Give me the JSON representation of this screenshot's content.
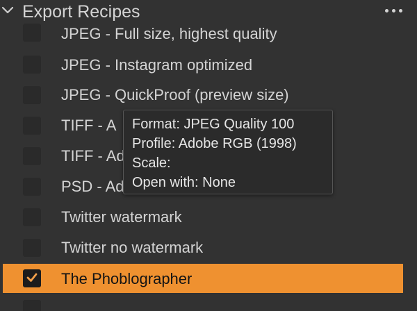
{
  "colors": {
    "background": "#323232",
    "selected_row": "#ef9130",
    "checkbox_fill": "#2a2a2a",
    "tooltip_bg": "#2b2b2b",
    "text": "#d4d4d4"
  },
  "header": {
    "title": "Export Recipes",
    "collapse_icon": "chevron-down-icon",
    "menu_icon": "more-horizontal-icon"
  },
  "recipes": [
    {
      "label": "JPEG - Full size, highest quality",
      "checked": false
    },
    {
      "label": "JPEG - Instagram optimized",
      "checked": false
    },
    {
      "label": "JPEG - QuickProof (preview size)",
      "checked": false
    },
    {
      "label": "TIFF - A",
      "checked": false
    },
    {
      "label": "TIFF - Ad",
      "checked": false
    },
    {
      "label": "PSD - Ad",
      "checked": false
    },
    {
      "label": "Twitter watermark",
      "checked": false
    },
    {
      "label": "Twitter no watermark",
      "checked": false
    },
    {
      "label": "The Phoblographer",
      "checked": true,
      "selected": true
    }
  ],
  "tooltip": {
    "format": "Format: JPEG Quality 100",
    "profile": "Profile: Adobe RGB (1998)",
    "scale": "Scale:",
    "open_with": "Open with: None"
  }
}
